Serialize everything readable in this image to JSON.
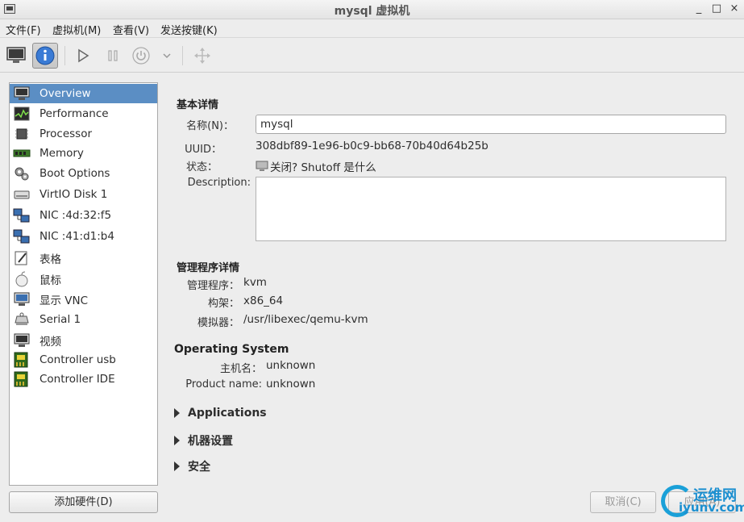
{
  "window": {
    "title": "mysql 虚拟机",
    "minimize": "_",
    "maximize": "□",
    "close": "×"
  },
  "menu": [
    "文件(F)",
    "虚拟机(M)",
    "查看(V)",
    "发送按键(K)"
  ],
  "toolbar": {
    "console_icon": "monitor-icon",
    "details_icon": "info-icon",
    "run_icon": "play-icon",
    "pause_icon": "pause-icon",
    "shutdown_icon": "power-icon",
    "shutdown_menu_icon": "chevron-down-icon",
    "fullscreen_icon": "move-icon"
  },
  "hardware": [
    {
      "label": "Overview",
      "icon": "monitor-icon",
      "selected": true
    },
    {
      "label": "Performance",
      "icon": "chart-icon"
    },
    {
      "label": "Processor",
      "icon": "cpu-icon"
    },
    {
      "label": "Memory",
      "icon": "memory-icon"
    },
    {
      "label": "Boot Options",
      "icon": "gears-icon"
    },
    {
      "label": "VirtIO Disk 1",
      "icon": "disk-icon"
    },
    {
      "label": "NIC :4d:32:f5",
      "icon": "network-icon"
    },
    {
      "label": "NIC :41:d1:b4",
      "icon": "network-icon"
    },
    {
      "label": "表格",
      "icon": "tablet-icon"
    },
    {
      "label": "鼠标",
      "icon": "mouse-icon"
    },
    {
      "label": "显示 VNC",
      "icon": "display-icon"
    },
    {
      "label": "Serial 1",
      "icon": "serial-icon"
    },
    {
      "label": "视频",
      "icon": "video-icon"
    },
    {
      "label": "Controller usb",
      "icon": "controller-icon"
    },
    {
      "label": "Controller IDE",
      "icon": "controller-icon"
    }
  ],
  "add_hardware": "添加硬件(D)",
  "basic": {
    "title": "基本详情",
    "name_label": "名称(N)：",
    "name_value": "mysql",
    "uuid_label": "UUID：",
    "uuid_value": "308dbf89-1e96-b0c9-bb68-70b40d64b25b",
    "status_label": "状态：",
    "status_value": "关闭? Shutoff 是什么",
    "desc_label": "Description:"
  },
  "hypervisor": {
    "title": "管理程序详情",
    "hv_label": "管理程序：",
    "hv_value": "kvm",
    "arch_label": "构架：",
    "arch_value": "x86_64",
    "emu_label": "模拟器：",
    "emu_value": "/usr/libexec/qemu-kvm"
  },
  "os": {
    "title": "Operating System",
    "host_label": "主机名：",
    "host_value": "unknown",
    "product_label": "Product name:",
    "product_value": "unknown"
  },
  "expanders": [
    "Applications",
    "机器设置",
    "安全"
  ],
  "buttons": {
    "cancel": "取消(C)",
    "apply": "应用(A)"
  },
  "watermark": {
    "line1": "运维网",
    "line2": "iyunv.com"
  }
}
